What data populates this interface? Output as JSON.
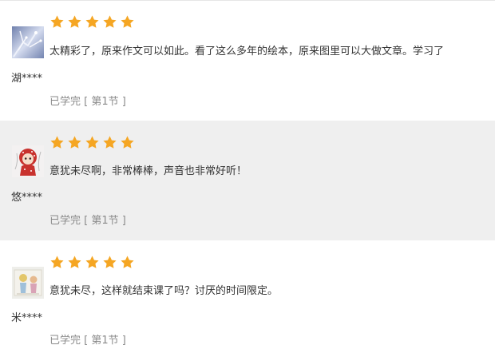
{
  "reviews": [
    {
      "username": "湖****",
      "rating": 5,
      "comment": "太精彩了，原来作文可以如此。看了这么多年的绘本，原来图里可以大做文章。学习了",
      "status": "已学完 [ 第1节 ]",
      "avatar_icon": "snowy-branch-photo"
    },
    {
      "username": "悠****",
      "rating": 5,
      "comment": "意犹未尽啊，非常棒棒，声音也非常好听！",
      "status": "已学完 [ 第1节 ]",
      "avatar_icon": "doll-photo"
    },
    {
      "username": "米****",
      "rating": 5,
      "comment": "意犹未尽，这样就结束课了吗？讨厌的时间限定。",
      "status": "已学完 [ 第1节 ]",
      "avatar_icon": "toy-figure-photo"
    }
  ],
  "colors": {
    "star": "#f5a623",
    "status_text": "#8a8a8a",
    "alt_row_bg": "#efefef"
  }
}
